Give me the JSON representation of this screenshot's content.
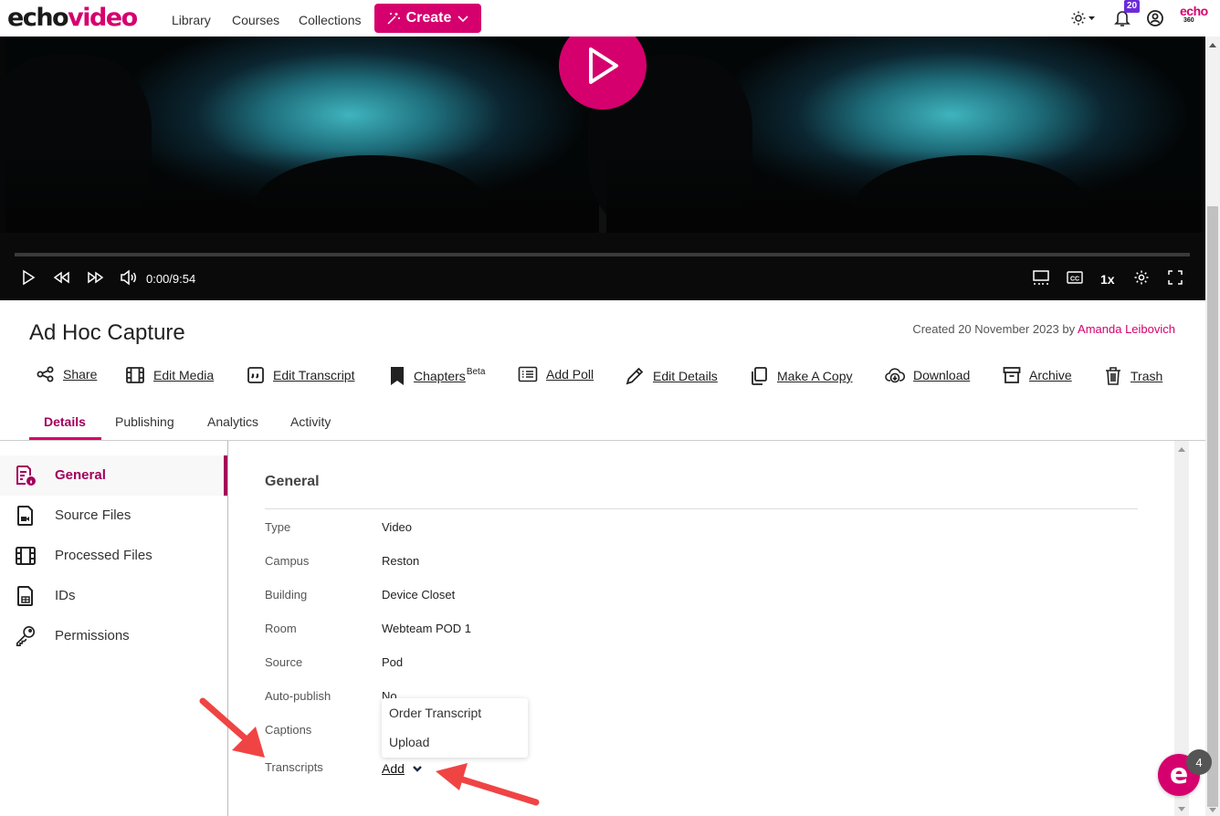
{
  "app": {
    "logo_part1": "echo",
    "logo_part2": "video",
    "brand_mark": "echo",
    "brand_mark_sub": "360"
  },
  "nav": {
    "links": [
      "Library",
      "Courses",
      "Collections"
    ],
    "create_label": "Create",
    "notification_count": "20"
  },
  "player": {
    "time": "0:00/9:54",
    "speed": "1x",
    "progress": 0
  },
  "media": {
    "title": "Ad Hoc Capture",
    "created_prefix": "Created 20 November 2023 by",
    "created_by": "Amanda Leibovich"
  },
  "actions": [
    {
      "label": "Share",
      "icon": "share-icon"
    },
    {
      "label": "Edit Media",
      "icon": "film-icon"
    },
    {
      "label": "Edit Transcript",
      "icon": "quote-icon"
    },
    {
      "label": "Chapters",
      "sup": "Beta",
      "icon": "bookmark-icon"
    },
    {
      "label": "Add Poll",
      "icon": "list-icon"
    },
    {
      "label": "Edit Details",
      "icon": "pencil-icon"
    },
    {
      "label": "Make A Copy",
      "icon": "copy-icon"
    },
    {
      "label": "Download",
      "icon": "cloud-download-icon"
    },
    {
      "label": "Archive",
      "icon": "archive-icon"
    },
    {
      "label": "Trash",
      "icon": "trash-icon"
    }
  ],
  "tabs": [
    {
      "label": "Details",
      "active": true
    },
    {
      "label": "Publishing"
    },
    {
      "label": "Analytics"
    },
    {
      "label": "Activity"
    }
  ],
  "sidebar": {
    "items": [
      {
        "label": "General",
        "icon": "document-info-icon",
        "active": true
      },
      {
        "label": "Source Files",
        "icon": "video-file-icon"
      },
      {
        "label": "Processed Files",
        "icon": "film-icon"
      },
      {
        "label": "IDs",
        "icon": "table-file-icon"
      },
      {
        "label": "Permissions",
        "icon": "key-icon"
      }
    ]
  },
  "general": {
    "section_title": "General",
    "rows": [
      {
        "label": "Type",
        "value": "Video"
      },
      {
        "label": "Campus",
        "value": "Reston"
      },
      {
        "label": "Building",
        "value": "Device Closet"
      },
      {
        "label": "Room",
        "value": "Webteam POD 1"
      },
      {
        "label": "Source",
        "value": "Pod"
      },
      {
        "label": "Auto-publish",
        "value": "No"
      },
      {
        "label": "Captions",
        "value": ""
      },
      {
        "label": "Transcripts",
        "value": ""
      }
    ],
    "transcripts_add_label": "Add",
    "dropdown_options": [
      "Order Transcript",
      "Upload"
    ]
  },
  "chat": {
    "glyph": "e",
    "badge_count": "4"
  },
  "colors": {
    "brand": "#d5006d",
    "active_text": "#a3005a",
    "annotation_arrow": "#f04444"
  }
}
